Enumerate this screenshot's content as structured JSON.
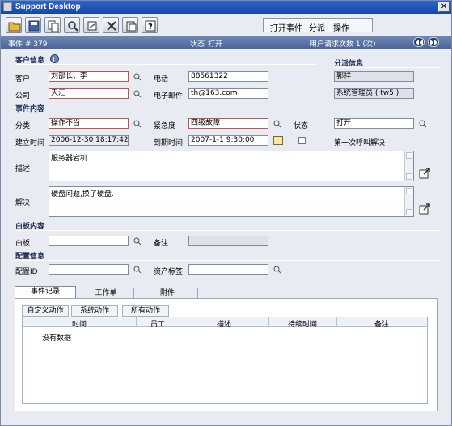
{
  "window": {
    "title": "Support Desktop",
    "close": "✕"
  },
  "toolbar": {
    "buttons": [
      "open-folder-icon",
      "save-icon",
      "copy-icon",
      "search-icon",
      "refresh-icon",
      "delete-icon",
      "paste-icon",
      "help-icon"
    ],
    "menu": {
      "open_event": "打开事件",
      "assign": "分派",
      "action": "操作"
    }
  },
  "status": {
    "event_label": "事件 # 379",
    "state_label": "状态",
    "state_value": "打开",
    "request_count": "用户请求次数 1 (次)"
  },
  "customer": {
    "heading": "客户信息",
    "customer_label": "客户",
    "customer_value": "刘部长、李",
    "phone_label": "电话",
    "phone_value": "88561322",
    "company_label": "公司",
    "company_value": "天汇",
    "email_label": "电子邮件",
    "email_value": "th@163.com"
  },
  "assign": {
    "heading": "分派信息",
    "person": "郭祥",
    "group": "系统管理员 ( tw5 )"
  },
  "event": {
    "heading": "事件内容",
    "category_label": "分类",
    "category_value": "操作不当",
    "urgency_label": "紧急度",
    "urgency_value": "四级故障",
    "state_label": "状态",
    "state_value": "打开",
    "created_label": "建立时间",
    "created_value": "2006-12-30 18:17:42",
    "due_label": "到期时间",
    "due_value": "2007-1-1 9:30:00",
    "first_call_label": "第一次呼叫解决",
    "desc_label": "描述",
    "desc_value": "服务器宕机",
    "solution_label": "解决",
    "solution_value": "硬盘问题,换了硬盘."
  },
  "whiteboard": {
    "heading": "白板内容",
    "board_label": "白板",
    "board_value": "",
    "note_label": "备注",
    "note_value": ""
  },
  "config": {
    "heading": "配置信息",
    "id_label": "配置ID",
    "id_value": "",
    "asset_label": "资产标签",
    "asset_value": ""
  },
  "tabs": [
    "事件记录",
    "工作单",
    "附件"
  ],
  "subtabs": [
    "自定义动作",
    "系统动作",
    "所有动作"
  ],
  "grid": {
    "columns": [
      "时间",
      "员工",
      "描述",
      "持续时间",
      "备注"
    ],
    "empty": "没有数据"
  }
}
